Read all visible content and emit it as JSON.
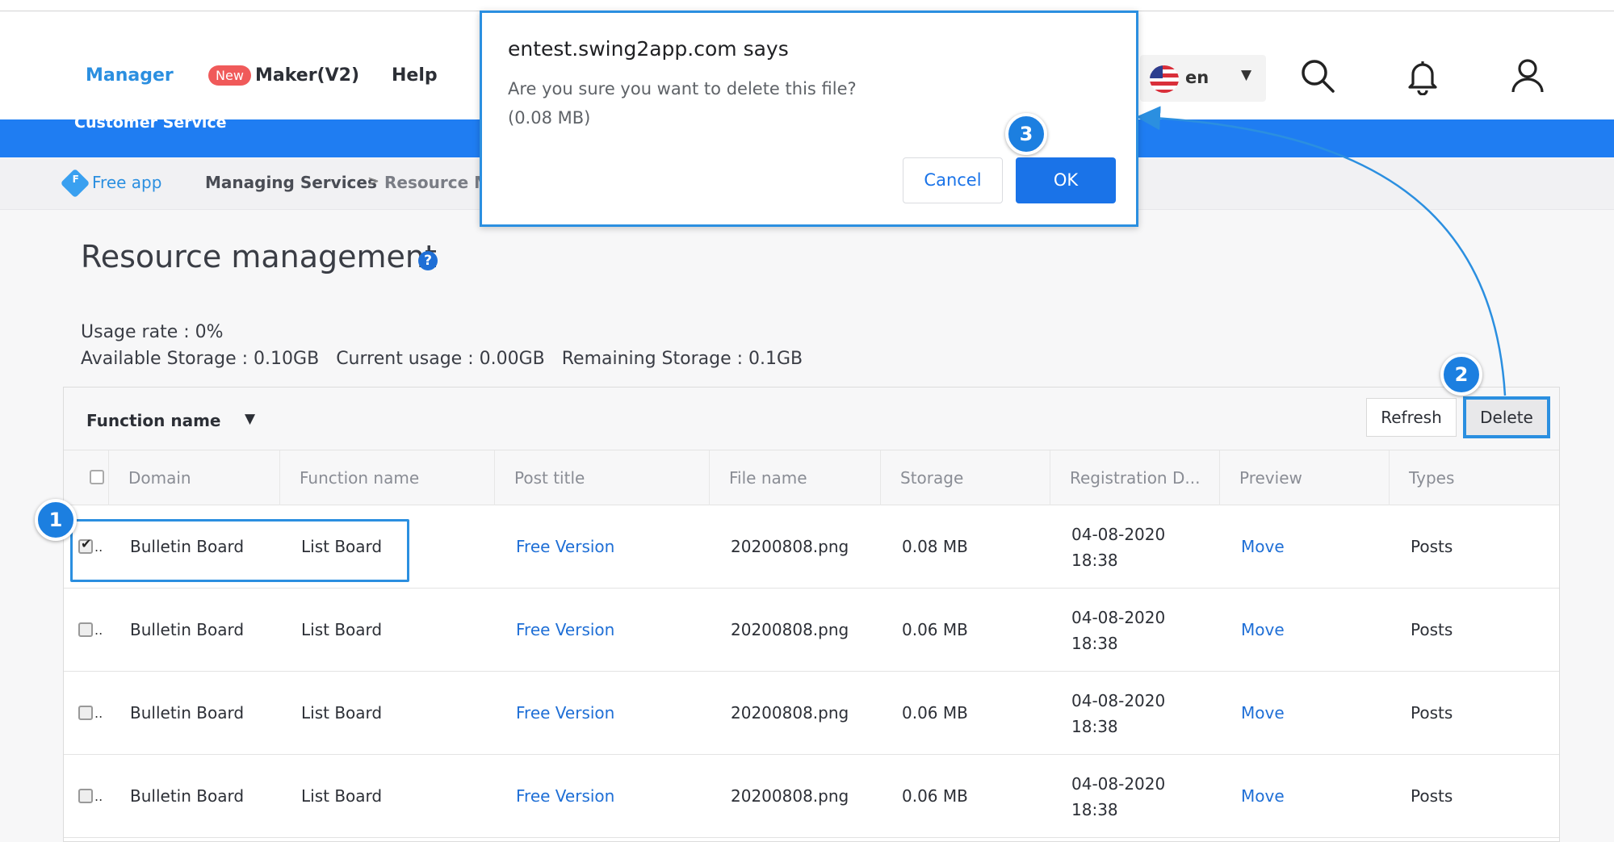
{
  "nav": {
    "manager": "Manager",
    "new_badge": "New",
    "maker": "Maker(V2)",
    "help": "Help",
    "language": "en",
    "customer_service": "Customer Service"
  },
  "breadcrumb": {
    "free_badge": "F",
    "free_app": "Free app",
    "managing_services": "Managing Services",
    "separator": ">",
    "resource": "Resource Management"
  },
  "page": {
    "title": "Resource management",
    "help_icon": "?",
    "usage_rate": "Usage rate : 0%",
    "available_storage": "Available Storage : 0.10GB",
    "current_usage": "Current usage : 0.00GB",
    "remaining_storage": "Remaining Storage : 0.1GB"
  },
  "toolbar": {
    "function_select": "Function name",
    "refresh": "Refresh",
    "delete": "Delete"
  },
  "table": {
    "headers": [
      "Domain",
      "Function name",
      "Post title",
      "File name",
      "Storage",
      "Registration D...",
      "Preview",
      "Types"
    ],
    "rows": [
      {
        "checked": true,
        "domain": "Bulletin Board",
        "function": "List Board",
        "post_title": "Free Version",
        "file": "20200808.png",
        "storage": "0.08 MB",
        "date": "04-08-2020",
        "time": "18:38",
        "preview": "Move",
        "type": "Posts"
      },
      {
        "checked": false,
        "domain": "Bulletin Board",
        "function": "List Board",
        "post_title": "Free Version",
        "file": "20200808.png",
        "storage": "0.06 MB",
        "date": "04-08-2020",
        "time": "18:38",
        "preview": "Move",
        "type": "Posts"
      },
      {
        "checked": false,
        "domain": "Bulletin Board",
        "function": "List Board",
        "post_title": "Free Version",
        "file": "20200808.png",
        "storage": "0.06 MB",
        "date": "04-08-2020",
        "time": "18:38",
        "preview": "Move",
        "type": "Posts"
      },
      {
        "checked": false,
        "domain": "Bulletin Board",
        "function": "List Board",
        "post_title": "Free Version",
        "file": "20200808.png",
        "storage": "0.06 MB",
        "date": "04-08-2020",
        "time": "18:38",
        "preview": "Move",
        "type": "Posts"
      }
    ]
  },
  "dialog": {
    "title": "entest.swing2app.com says",
    "message": "Are you sure you want to delete this file?",
    "size": "(0.08 MB)",
    "cancel": "Cancel",
    "ok": "OK"
  },
  "steps": [
    "1",
    "2",
    "3"
  ],
  "colors": {
    "accent": "#1f7df2",
    "link": "#1f6fd6",
    "highlight": "#2b8fe0",
    "new_badge": "#f05a5a"
  }
}
